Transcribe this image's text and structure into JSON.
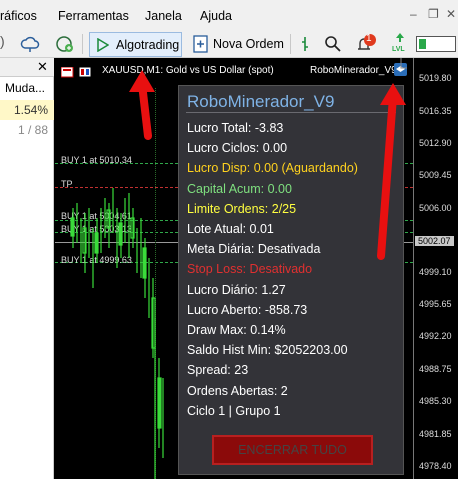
{
  "menu": {
    "items": [
      "ráficos",
      "Ferramentas",
      "Janela",
      "Ajuda"
    ]
  },
  "toolbar": {
    "algotrading_label": "Algotrading",
    "nova_ordem_label": "Nova Ordem",
    "notification_count": "1",
    "lvl_label": "LVL"
  },
  "left_panel": {
    "header": "Muda...",
    "rows": [
      "1.54%",
      "1 / 88"
    ]
  },
  "chart": {
    "symbol_title": "XAUUSD,M1:  Gold vs US Dollar (spot)",
    "ea_name": "RoboMinerador_V9",
    "price_ticks": [
      "5019.80",
      "5016.35",
      "5012.90",
      "5009.45",
      "5006.00",
      "5002.07",
      "4999.10",
      "4995.65",
      "4992.20",
      "4988.75",
      "4985.30",
      "4981.85",
      "4978.40"
    ],
    "current_price": "5002.07",
    "order_labels": [
      "BUY 1 at 5010.34",
      "TP",
      "BUY 1 at 5004.61",
      "BUY 1 at 5003.13",
      "BUY 1 at 4999.63"
    ]
  },
  "panel": {
    "title": "RoboMinerador_V9",
    "rows": [
      {
        "text": "Lucro Total: -3.83",
        "color": "#ffffff"
      },
      {
        "text": "Lucro Ciclos: 0.00",
        "color": "#ffffff"
      },
      {
        "text": "Lucro Disp: 0.00 (Aguardando)",
        "color": "#ffd21f"
      },
      {
        "text": "Capital Acum: 0.00",
        "color": "#7fe07f"
      },
      {
        "text": "Limite Ordens: 2/25",
        "color": "#ffff40"
      },
      {
        "text": "Lote Atual: 0.01",
        "color": "#ffffff"
      },
      {
        "text": "Meta Diária: Desativada",
        "color": "#ffffff"
      },
      {
        "text": "Stop Loss: Desativado",
        "color": "#e03030"
      },
      {
        "text": "Lucro Diário: 1.27",
        "color": "#ffffff"
      },
      {
        "text": "Lucro Aberto: -858.73",
        "color": "#ffffff"
      },
      {
        "text": "Draw Max: 0.14%",
        "color": "#ffffff"
      },
      {
        "text": "Saldo Hist Min: $2052203.00",
        "color": "#ffffff"
      },
      {
        "text": "Spread: 23",
        "color": "#ffffff"
      },
      {
        "text": "Ordens Abertas: 2",
        "color": "#ffffff"
      },
      {
        "text": "Ciclo 1 | Grupo 1",
        "color": "#ffffff"
      }
    ],
    "button_label": "ENCERRAR TUDO"
  },
  "colors": {
    "annotation_arrow": "#e81010",
    "panel_bg": "#333338",
    "title_blue": "#7fb3e6"
  }
}
